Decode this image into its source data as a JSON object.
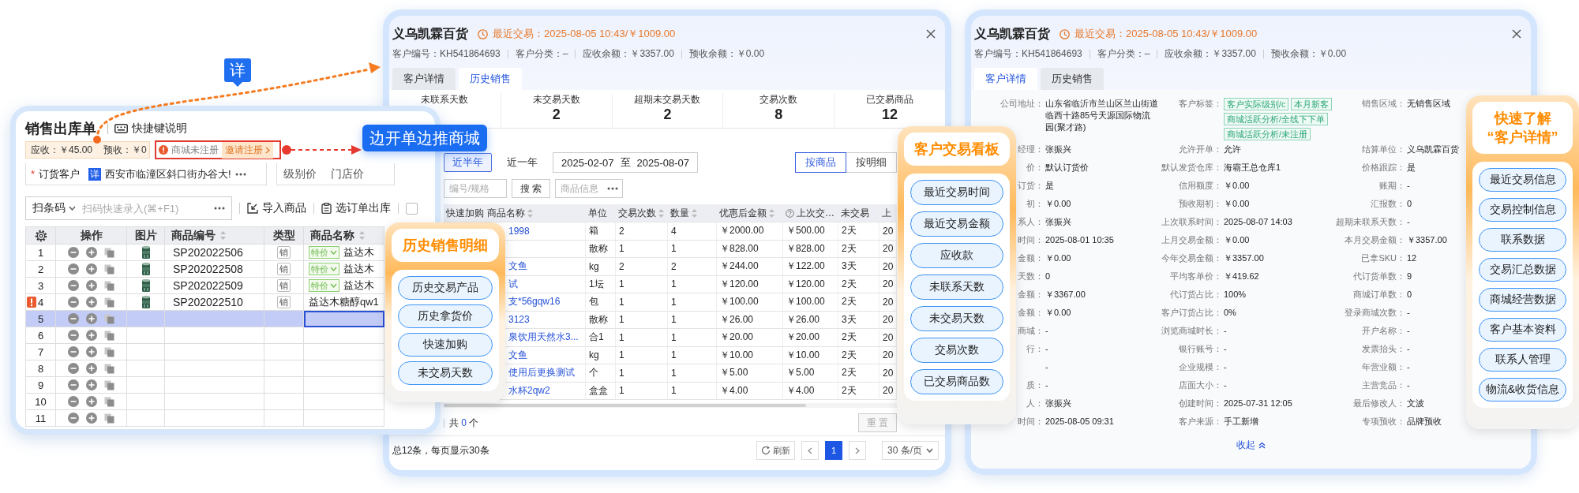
{
  "sales_order": {
    "title": "销售出库单",
    "shortcut_help": "快捷键说明",
    "receivable": "应收：￥45.00",
    "prepaid": "预收：￥0",
    "mall_status": "商城未注册",
    "invite": "邀请注册",
    "required_mark": "*",
    "customer_label": "订货客户",
    "detail_tag": "详",
    "customer": "西安市临潼区斜口街办谷大!",
    "price_levels": [
      "级别价",
      "门店价"
    ],
    "scan_mode": "扫条码",
    "scan_placeholder": "扫码快速录入(⌘+F1)",
    "actions": [
      {
        "kind": "import",
        "label": "导入商品"
      },
      {
        "kind": "order",
        "label": "选订单出库"
      }
    ],
    "select_checked": false,
    "columns": [
      {
        "kind": "settings"
      },
      {
        "kind": "text",
        "label": "操作",
        "sortable": false
      },
      {
        "kind": "text",
        "label": "图片",
        "sortable": false
      },
      {
        "kind": "text",
        "label": "商品编号",
        "sortable": true
      },
      {
        "kind": "text",
        "label": "类型",
        "sortable": false
      },
      {
        "kind": "text",
        "label": "商品名称",
        "sortable": true
      }
    ],
    "rows": [
      {
        "no": "1",
        "has_picture": true,
        "code": "SP202022506",
        "type": "销",
        "price_tag": "特价",
        "name": "益达木",
        "warning": false,
        "selected": false
      },
      {
        "no": "2",
        "has_picture": true,
        "code": "SP202022508",
        "type": "销",
        "price_tag": "特价",
        "name": "益达木",
        "warning": false,
        "selected": false
      },
      {
        "no": "3",
        "has_picture": true,
        "code": "SP202022509",
        "type": "销",
        "price_tag": "特价",
        "name": "益达木",
        "warning": false,
        "selected": false
      },
      {
        "no": "4",
        "has_picture": true,
        "code": "SP202022510",
        "type": "销",
        "name": "益达木糖醇qw1",
        "warning": true,
        "selected": false
      },
      {
        "no": "5",
        "has_picture": false,
        "warning": false,
        "selected": true
      },
      {
        "no": "6",
        "has_picture": false,
        "warning": false,
        "selected": false
      },
      {
        "no": "7",
        "has_picture": false,
        "warning": false,
        "selected": false
      },
      {
        "no": "8",
        "has_picture": false,
        "warning": false,
        "selected": false
      },
      {
        "no": "9",
        "has_picture": false,
        "warning": false,
        "selected": false
      },
      {
        "no": "10",
        "has_picture": false,
        "warning": false,
        "selected": false
      },
      {
        "no": "11",
        "has_picture": false,
        "warning": false,
        "selected": false
      }
    ]
  },
  "callouts": {
    "detail_tag": "详",
    "push_banner": "边开单边推商城"
  },
  "history_window": {
    "kind": "history",
    "title": "义乌凯霖百货",
    "last_trade": "最近交易：2025-08-05 10:43/￥1009.00",
    "info": [
      "客户编号：KH541864693",
      "客户分类：–",
      "应收余额：￥3357.00",
      "预收余额：￥0.00"
    ],
    "tabs": [
      {
        "label": "客户详情",
        "selected": false
      },
      {
        "label": "历史销售",
        "selected": true
      }
    ],
    "stats": [
      {
        "label": "未联系天数"
      },
      {
        "label": "未交易天数",
        "value": "2"
      },
      {
        "label": "超期未交易天数",
        "value": "2"
      },
      {
        "label": "交易次数",
        "value": "8"
      },
      {
        "label": "已交易商品",
        "value": "12"
      }
    ],
    "periods": [
      {
        "label": "近半年",
        "selected": true
      },
      {
        "label": "近一年",
        "selected": false
      }
    ],
    "date_start": "2025-02-07",
    "date_sep": "至",
    "date_end": "2025-08-07",
    "views": [
      {
        "label": "按商品",
        "selected": true
      },
      {
        "label": "按明细",
        "selected": false
      }
    ],
    "search_placeholder": "编号/规格",
    "search_button": "搜 索",
    "filter_placeholder": "商品信息",
    "columns": [
      {
        "label": "快速加购",
        "sortable": false,
        "help": false
      },
      {
        "label": "商品名称",
        "sortable": true,
        "help": false
      },
      {
        "label": "单位",
        "sortable": false,
        "help": false
      },
      {
        "label": "交易次数",
        "sortable": true,
        "help": false
      },
      {
        "label": "数量",
        "sortable": true,
        "help": false
      },
      {
        "label": "优惠后金额",
        "sortable": true,
        "help": false
      },
      {
        "label": "上次交…",
        "sortable": false,
        "help": true
      },
      {
        "label": "未交易",
        "sortable": false,
        "help": false
      },
      {
        "label": "上",
        "sortable": false,
        "help": false
      }
    ],
    "rows": [
      {
        "cells": [
          "",
          "1998",
          "箱",
          "2",
          "4",
          "￥2000.00",
          "￥500.00",
          "2天",
          "20"
        ]
      },
      {
        "cells": [
          "",
          "",
          "散称",
          "1",
          "1",
          "￥828.00",
          "￥828.00",
          "2天",
          "20"
        ]
      },
      {
        "cells": [
          "",
          "文鱼",
          "kg",
          "2",
          "2",
          "￥244.00",
          "￥122.00",
          "3天",
          "20"
        ]
      },
      {
        "cells": [
          "",
          "试",
          "1坛",
          "1",
          "1",
          "￥120.00",
          "￥120.00",
          "2天",
          "20"
        ]
      },
      {
        "cells": [
          "",
          "支*56gqw16",
          "包",
          "1",
          "1",
          "￥100.00",
          "￥100.00",
          "2天",
          "20"
        ]
      },
      {
        "cells": [
          "",
          "3123",
          "散称",
          "1",
          "1",
          "￥26.00",
          "￥26.00",
          "3天",
          "20"
        ]
      },
      {
        "cells": [
          "",
          "泉饮用天然水3...",
          "合1",
          "1",
          "1",
          "￥20.00",
          "￥20.00",
          "2天",
          "20"
        ]
      },
      {
        "cells": [
          "",
          "文鱼",
          "kg",
          "1",
          "1",
          "￥10.00",
          "￥10.00",
          "2天",
          "20"
        ]
      },
      {
        "cells": [
          "",
          "使用后更换测试",
          "个",
          "1",
          "1",
          "￥5.00",
          "￥5.00",
          "2天",
          "20"
        ]
      },
      {
        "cells": [
          "",
          "水杯2qw2",
          "盒盒",
          "1",
          "1",
          "￥4.00",
          "￥4.00",
          "2天",
          "20"
        ]
      }
    ],
    "selected_prefix": "共",
    "selected_count": "0",
    "selected_suffix": "个",
    "reset": "重 置",
    "total": "总12条，每页显示30条",
    "refresh": "刷新",
    "pages": [
      {
        "label": "1",
        "selected": true
      }
    ],
    "page_size": "30 条/页"
  },
  "detail_window": {
    "kind": "detail",
    "title": "义乌凯霖百货",
    "last_trade": "最近交易：2025-08-05 10:43/￥1009.00",
    "info": [
      "客户编号：KH541864693",
      "客户分类：–",
      "应收余额：￥3357.00",
      "预收余额：￥0.00"
    ],
    "tabs": [
      {
        "label": "客户详情",
        "selected": true
      },
      {
        "label": "历史销售",
        "selected": false
      }
    ],
    "fields": [
      [
        {
          "label": "公司地址：",
          "value": "山东省临沂市兰山区兰山街道临西十路85号天源国际物流园(聚才路)"
        },
        {
          "label": "客户标签：",
          "tags": [
            "客户实际级别/c",
            "本月新客",
            "商城活跃分析/全线下下单",
            "商城活跃分析/未注册"
          ]
        },
        {
          "label": "销售区域：",
          "value": "无销售区域"
        }
      ],
      [
        {
          "label": "经理：",
          "value": "张振兴"
        },
        {
          "label": "允许开单：",
          "value": "允许"
        },
        {
          "label": "结算单位：",
          "value": "义乌凯霖百货"
        }
      ],
      [
        {
          "label": "价：",
          "value": "默认订货价"
        },
        {
          "label": "默认发货仓库：",
          "value": "海霸王总仓库1"
        },
        {
          "label": "价格跟踪：",
          "value": "是"
        }
      ],
      [
        {
          "label": "订货：",
          "value": "是"
        },
        {
          "label": "信用额度：",
          "value": "￥0.00"
        },
        {
          "label": "账期：",
          "value": "-"
        }
      ],
      [
        {
          "label": "初：",
          "value": "￥0.00"
        },
        {
          "label": "预收期初：",
          "value": "￥0.00"
        },
        {
          "label": "汇报数：",
          "value": "0"
        }
      ],
      [
        {
          "label": "系人：",
          "value": "张振兴"
        },
        {
          "label": "上次联系时间：",
          "value": "2025-08-07 14:03"
        },
        {
          "label": "超期未联系天数：",
          "value": "-"
        }
      ],
      [
        {
          "label": "时间：",
          "value": "2025-08-01 10:35"
        },
        {
          "label": "上月交易金额：",
          "value": "￥0.00"
        },
        {
          "label": "本月交易金额：",
          "value": "￥3357.00"
        }
      ],
      [
        {
          "label": "金额：",
          "value": "￥0.00"
        },
        {
          "label": "今年交易金额：",
          "value": "￥3357.00"
        },
        {
          "label": "已拿SKU：",
          "value": "12"
        }
      ],
      [
        {
          "label": "天数：",
          "value": "0"
        },
        {
          "label": "平均客单价：",
          "value": "￥419.62"
        },
        {
          "label": "代订货单数：",
          "value": "9"
        }
      ],
      [
        {
          "label": "金额：",
          "value": "￥3367.00"
        },
        {
          "label": "代订货占比：",
          "value": "100%"
        },
        {
          "label": "商城订单数：",
          "value": "0"
        }
      ],
      [
        {
          "label": "金额：",
          "value": "￥0.00"
        },
        {
          "label": "客户订货占比：",
          "value": "0%"
        },
        {
          "label": "登录商城次数：",
          "value": "-"
        }
      ],
      [
        {
          "label": "商城：",
          "value": "-"
        },
        {
          "label": "浏览商城时长：",
          "value": "-"
        },
        {
          "label": "开户名称：",
          "value": "-"
        }
      ],
      [
        {
          "label": "行：",
          "value": "-"
        },
        {
          "label": "银行账号：",
          "value": "-"
        },
        {
          "label": "发票抬头：",
          "value": "-"
        }
      ],
      [
        {
          "value": "-"
        },
        {
          "label": "企业规模：",
          "value": "-"
        },
        {
          "label": "年营业额：",
          "value": "-"
        }
      ],
      [
        {
          "label": "质：",
          "value": "-"
        },
        {
          "label": "店面大小：",
          "value": "-"
        },
        {
          "label": "主营竞品：",
          "value": "-"
        }
      ],
      [
        {
          "label": "人：",
          "value": "张振兴"
        },
        {
          "label": "创建时间：",
          "value": "2025-07-31 12:05"
        },
        {
          "label": "最后修改人：",
          "value": "文波"
        }
      ],
      [
        {
          "label": "时间：",
          "value": "2025-08-05 09:31"
        },
        {
          "label": "客户来源：",
          "value": "手工新增"
        },
        {
          "label": "专项预收：",
          "value": "品牌预收"
        }
      ]
    ],
    "collapse": "收起"
  },
  "feature_cards": [
    {
      "title": [
        "历史销售明细"
      ],
      "buttons": [
        "历史交易产品",
        "历史拿货价",
        "快速加购",
        "未交易天数"
      ]
    },
    {
      "title": [
        "客户交易看板"
      ],
      "buttons": [
        "最近交易时间",
        "最近交易金额",
        "应收款",
        "未联系天数",
        "未交易天数",
        "交易次数",
        "已交易商品数"
      ]
    },
    {
      "title": [
        "快速了解",
        "“客户详情”"
      ],
      "buttons": [
        "最近交易信息",
        "交易控制信息",
        "联系数据",
        "交易汇总数据",
        "商城经营数据",
        "客户基本资料",
        "联系人管理",
        "物流&收货信息"
      ]
    }
  ]
}
